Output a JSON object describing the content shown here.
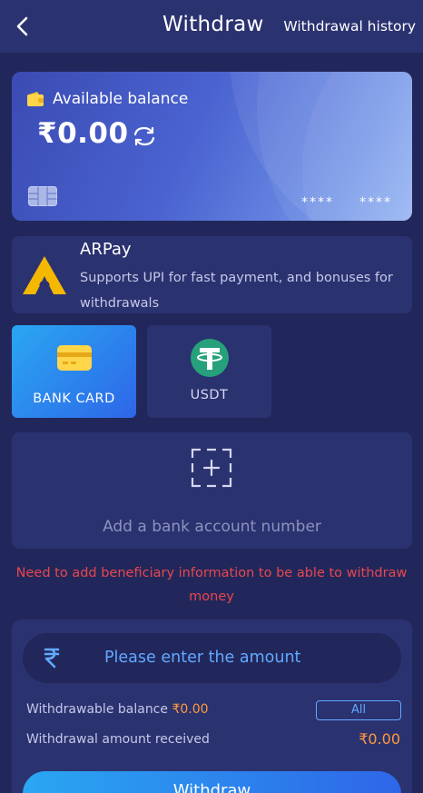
{
  "header": {
    "title": "Withdraw",
    "history_link": "Withdrawal history"
  },
  "balance_card": {
    "label": "Available balance",
    "amount": "₹0.00",
    "masked_segments": [
      "****",
      "****"
    ]
  },
  "arpay": {
    "name": "ARPay",
    "description": "Supports UPI for fast payment, and bonuses for withdrawals"
  },
  "methods": [
    {
      "label": "BANK CARD",
      "selected": true,
      "icon": "bank-card-icon"
    },
    {
      "label": "USDT",
      "selected": false,
      "icon": "tether-icon"
    }
  ],
  "add_bank": {
    "text": "Add a bank account number"
  },
  "warning": "Need to add beneficiary information to be able to withdraw money",
  "amount_panel": {
    "placeholder": "Please enter the amount",
    "withdrawable_label": "Withdrawable balance",
    "withdrawable_value": "₹0.00",
    "all_button": "All",
    "received_label": "Withdrawal amount received",
    "received_value": "₹0.00",
    "withdraw_button": "Withdraw"
  },
  "colors": {
    "background": "#22275b",
    "panel": "#2b3270",
    "accent_blue": "#61a9ff",
    "warning_red": "#e8464e",
    "orange": "#ff9a3c"
  }
}
